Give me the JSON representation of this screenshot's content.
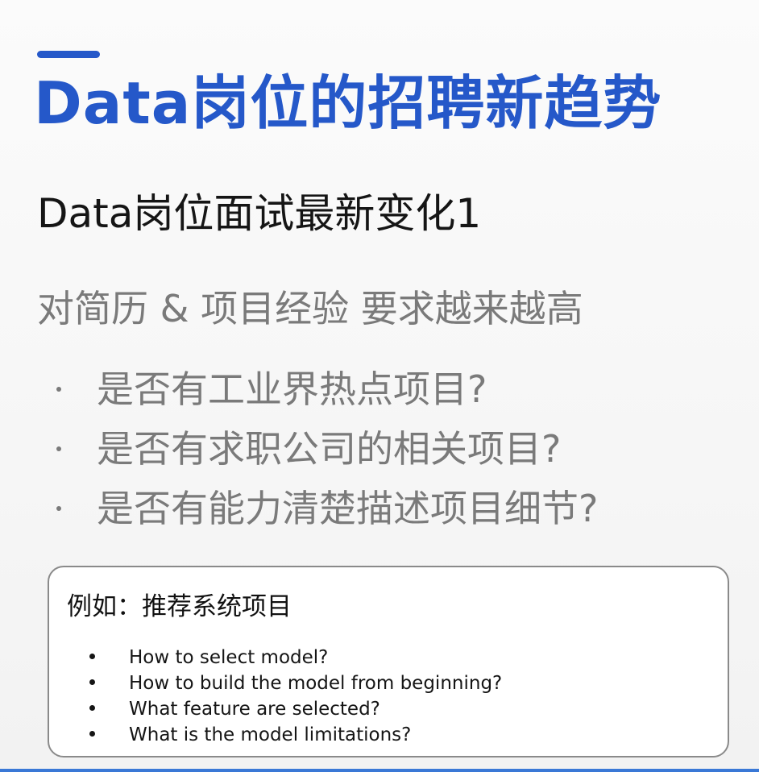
{
  "slide": {
    "title": "Data岗位的招聘新趋势",
    "subtitle": "Data岗位面试最新变化1",
    "requirement": "对简历 & 项目经验 要求越来越高",
    "questions": [
      "是否有工业界热点项目?",
      "是否有求职公司的相关项目?",
      "是否有能力清楚描述项目细节?"
    ],
    "example": {
      "heading": "例如：推荐系统项目",
      "items": [
        "How to select model?",
        "How to build the model from beginning?",
        "What feature are selected?",
        "What is the model limitations?"
      ]
    }
  },
  "colors": {
    "accent": "#2558c9",
    "title": "#2558c9",
    "body_gray": "#7a7a7a",
    "text_dark": "#151515",
    "box_border": "#8a8a8a",
    "bottom_line": "#3a78d6"
  }
}
